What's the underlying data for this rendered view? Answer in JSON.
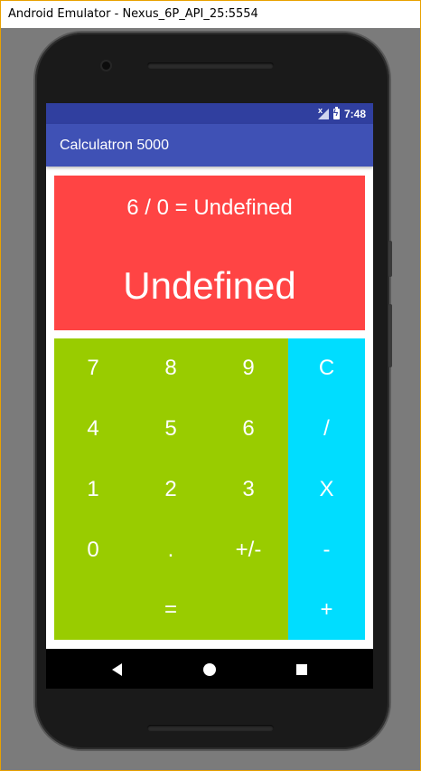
{
  "window": {
    "title": "Android Emulator - Nexus_6P_API_25:5554"
  },
  "status_bar": {
    "time": "7:48",
    "icons": [
      "no-signal-icon",
      "battery-charging-icon"
    ]
  },
  "app_bar": {
    "title": "Calculatron 5000"
  },
  "display": {
    "expression": "6 / 0 = Undefined",
    "result": "Undefined",
    "background": "#ff4444"
  },
  "keypad": {
    "number_color": "#99cc00",
    "operator_color": "#00ddff",
    "keys": {
      "k7": "7",
      "k8": "8",
      "k9": "9",
      "k4": "4",
      "k5": "5",
      "k6": "6",
      "k1": "1",
      "k2": "2",
      "k3": "3",
      "k0": "0",
      "dot": ".",
      "negate": "+/-",
      "equals": "=",
      "clear": "C",
      "divide": "/",
      "multiply": "X",
      "subtract": "-",
      "add": "+"
    }
  },
  "nav_bar": {
    "icons": [
      "back-icon",
      "home-icon",
      "recents-icon"
    ]
  },
  "colors": {
    "app_bar": "#3f51b5",
    "status_bar": "#303f9f"
  }
}
